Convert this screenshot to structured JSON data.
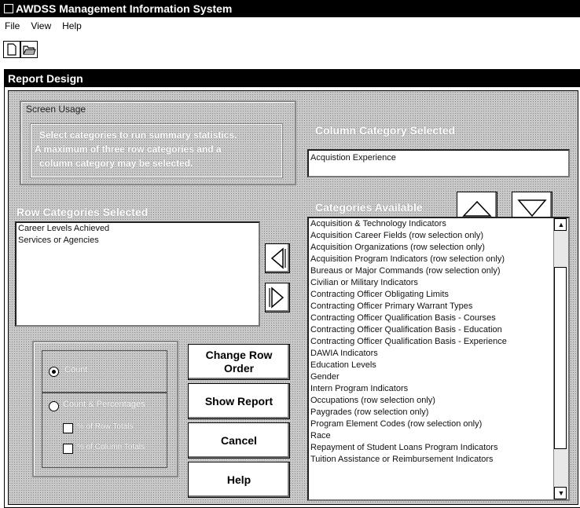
{
  "app": {
    "title": "AWDSS Management Information System"
  },
  "menu": {
    "file": "File",
    "view": "View",
    "help": "Help"
  },
  "window": {
    "title": "Report Design"
  },
  "screen_usage": {
    "label": "Screen Usage",
    "line1": "Select categories to run summary statistics.",
    "line2": "A maximum of three row categories and a",
    "line3": "column category may be selected."
  },
  "column_category": {
    "label": "Column Category Selected",
    "value": "Acquistion Experience"
  },
  "row_categories": {
    "label": "Row Categories Selected",
    "items": [
      "Career Levels Achieved",
      "Services or Agencies"
    ]
  },
  "categories_available": {
    "label": "Categories Available",
    "items": [
      "Acquisition & Technology Indicators",
      "Acquisition Career Fields (row selection only)",
      "Acquisition Organizations (row selection only)",
      "Acquisition Program Indicators (row selection only)",
      "Bureaus or Major Commands (row selection only)",
      "Civilian or Military Indicators",
      "Contracting Officer Obligating Limits",
      "Contracting Officer Primary Warrant Types",
      "Contracting Officer Qualification Basis - Courses",
      "Contracting Officer Qualification Basis - Education",
      "Contracting Officer Qualification Basis - Experience",
      "DAWIA Indicators",
      "Education Levels",
      "Gender",
      "Intern Program Indicators",
      "Occupations (row selection only)",
      "Paygrades (row selection only)",
      "Program Element Codes (row selection only)",
      "Race",
      "Repayment of Student Loans Program Indicators",
      "Tuition Assistance or Reimbursement Indicators"
    ]
  },
  "options": {
    "count": "Count",
    "count_percent": "Count & Percentages",
    "row_totals": "% of Row Totals",
    "col_totals": "% of Column Totals"
  },
  "buttons": {
    "change_row_line1": "Change Row",
    "change_row_line2": "Order",
    "show_report": "Show Report",
    "cancel": "Cancel",
    "help": "Help"
  }
}
